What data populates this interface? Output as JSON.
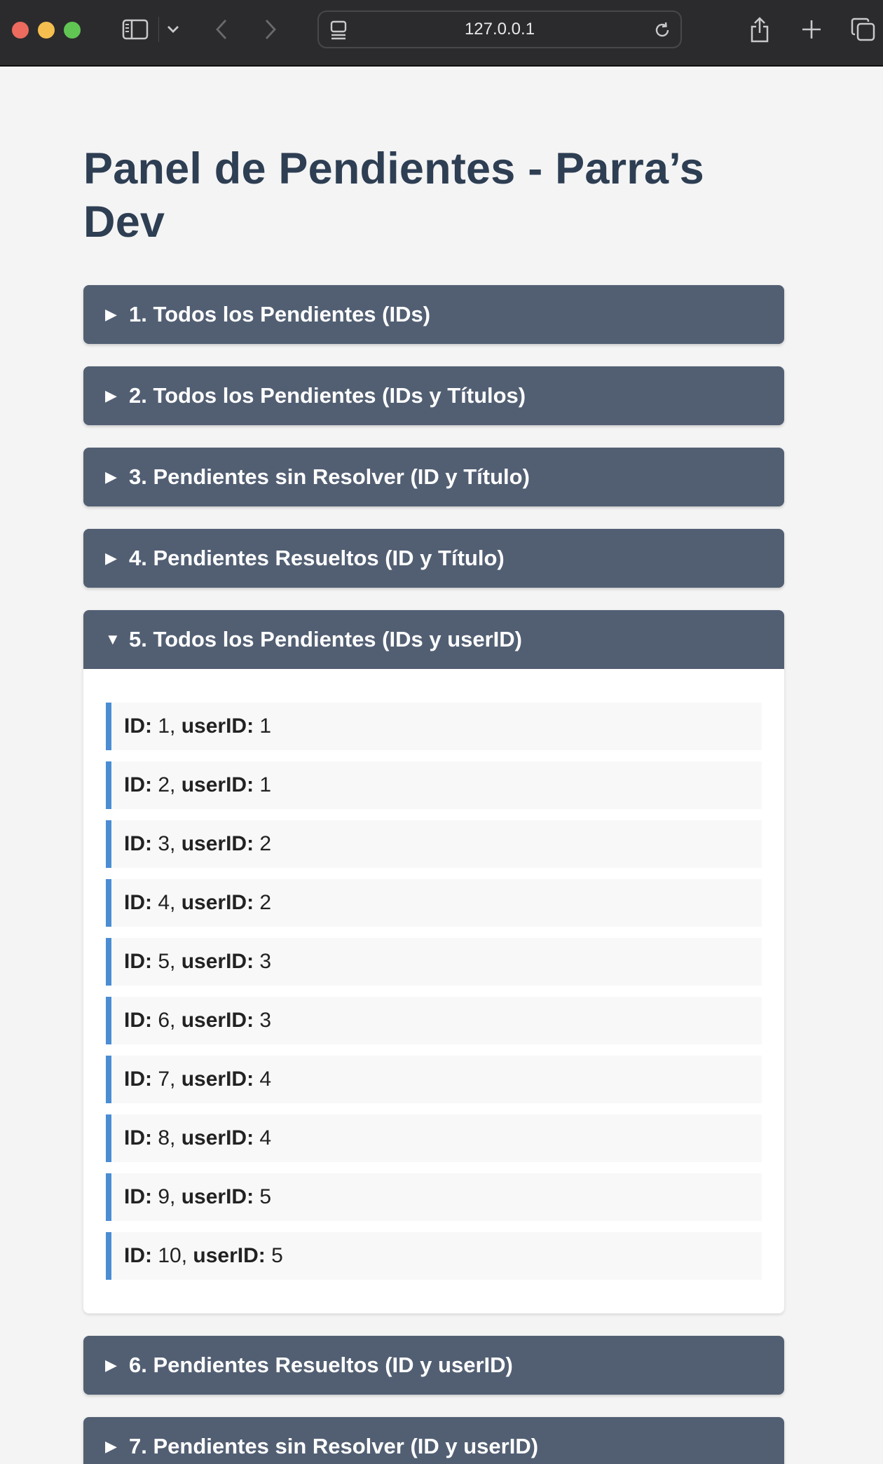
{
  "browser": {
    "url": "127.0.0.1"
  },
  "page": {
    "title": "Panel de Pendientes - Parra’s Dev"
  },
  "sections": [
    {
      "label": "1. Todos los Pendientes (IDs)",
      "open": false
    },
    {
      "label": "2. Todos los Pendientes (IDs y Títulos)",
      "open": false
    },
    {
      "label": "3. Pendientes sin Resolver (ID y Título)",
      "open": false
    },
    {
      "label": "4. Pendientes Resueltos (ID y Título)",
      "open": false
    },
    {
      "label": "5. Todos los Pendientes (IDs y userID)",
      "open": true
    },
    {
      "label": "6. Pendientes Resueltos (ID y userID)",
      "open": false
    },
    {
      "label": "7. Pendientes sin Resolver (ID y userID)",
      "open": false
    }
  ],
  "item_labels": {
    "id": "ID:",
    "user": "userID:"
  },
  "items": [
    {
      "id": "1",
      "user": "1"
    },
    {
      "id": "2",
      "user": "1"
    },
    {
      "id": "3",
      "user": "2"
    },
    {
      "id": "4",
      "user": "2"
    },
    {
      "id": "5",
      "user": "3"
    },
    {
      "id": "6",
      "user": "3"
    },
    {
      "id": "7",
      "user": "4"
    },
    {
      "id": "8",
      "user": "4"
    },
    {
      "id": "9",
      "user": "5"
    },
    {
      "id": "10",
      "user": "5"
    }
  ],
  "icons": {
    "collapsed": "▶",
    "expanded": "▼"
  }
}
